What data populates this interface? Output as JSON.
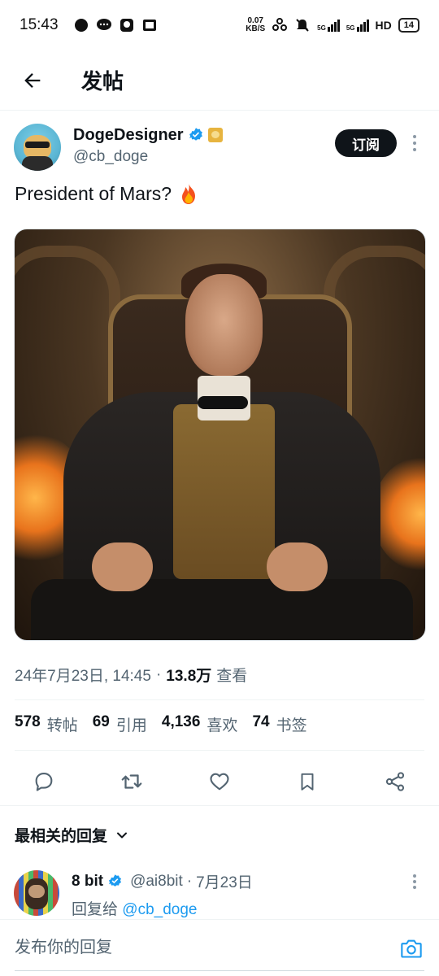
{
  "status_bar": {
    "time": "15:43",
    "net_speed_top": "0.07",
    "net_speed_bottom": "KB/S",
    "network_1": "5G",
    "network_2": "5G",
    "hd": "HD",
    "battery": "14"
  },
  "header": {
    "title": "发帖"
  },
  "tweet": {
    "author_name": "DogeDesigner",
    "author_handle": "@cb_doge",
    "subscribe_label": "订阅",
    "text": "President of Mars?",
    "timestamp": "24年7月23日, 14:45",
    "separator": "·",
    "views_count": "13.8万",
    "views_label": "查看"
  },
  "stats": [
    {
      "num": "578",
      "label": "转帖"
    },
    {
      "num": "69",
      "label": "引用"
    },
    {
      "num": "4,136",
      "label": "喜欢"
    },
    {
      "num": "74",
      "label": "书签"
    }
  ],
  "sort": {
    "label": "最相关的回复"
  },
  "reply": {
    "name": "8 bit",
    "handle": "@ai8bit",
    "dot": "·",
    "date": "7月23日",
    "reply_to_prefix": "回复给",
    "reply_to_handle": "@cb_doge"
  },
  "composer": {
    "placeholder": "发布你的回复"
  },
  "icons": {
    "back": "arrow-left-icon",
    "verified": "verified-badge-icon",
    "more": "more-vertical-icon",
    "reply": "comment-icon",
    "retweet": "retweet-icon",
    "like": "heart-icon",
    "bookmark": "bookmark-icon",
    "share": "share-icon",
    "camera": "camera-icon"
  },
  "colors": {
    "accent": "#1d9bf0",
    "text": "#0f1419",
    "muted": "#536471"
  }
}
